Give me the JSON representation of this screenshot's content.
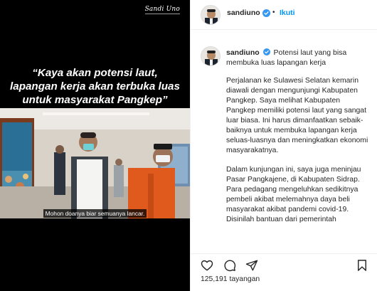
{
  "media": {
    "watermark": "Sandi Uno",
    "quote_lines": [
      "“Kaya akan potensi laut,",
      "lapangan kerja akan terbuka luas",
      "untuk masyarakat Pangkep”"
    ],
    "subtitle": "Mohon doanya biar semuanya lancar."
  },
  "header": {
    "username": "sandiuno",
    "separator": "•",
    "follow_label": "Ikuti"
  },
  "caption": {
    "username": "sandiuno",
    "headline": "Potensi laut yang bisa membuka luas lapangan kerja",
    "paragraphs": [
      "Perjalanan ke Sulawesi Selatan kemarin diawali dengan mengunjungi Kabupaten Pangkep. Saya melihat Kabupaten Pangkep memiliki potensi laut yang sangat luar biasa. Ini harus dimanfaatkan sebaik-baiknya untuk membuka lapangan kerja seluas-luasnya dan meningkatkan ekonomi masyarakatnya.",
      "Dalam kunjungan ini, saya juga meninjau Pasar Pangkajene, di Kabupaten Sidrap. Para pedagang mengeluhkan sedikitnya pembeli akibat melemahnya daya beli masyarakat akibat pandemi covid-19. Disinilah bantuan dari pemerintah"
    ]
  },
  "stats": {
    "views": "125,191 tayangan"
  },
  "icons": {
    "like": "heart-icon",
    "comment": "comment-icon",
    "share": "send-icon",
    "save": "bookmark-icon",
    "verified": "verified-badge-icon"
  },
  "colors": {
    "accent": "#0095f6",
    "verified": "#3897f0",
    "text": "#262626"
  }
}
